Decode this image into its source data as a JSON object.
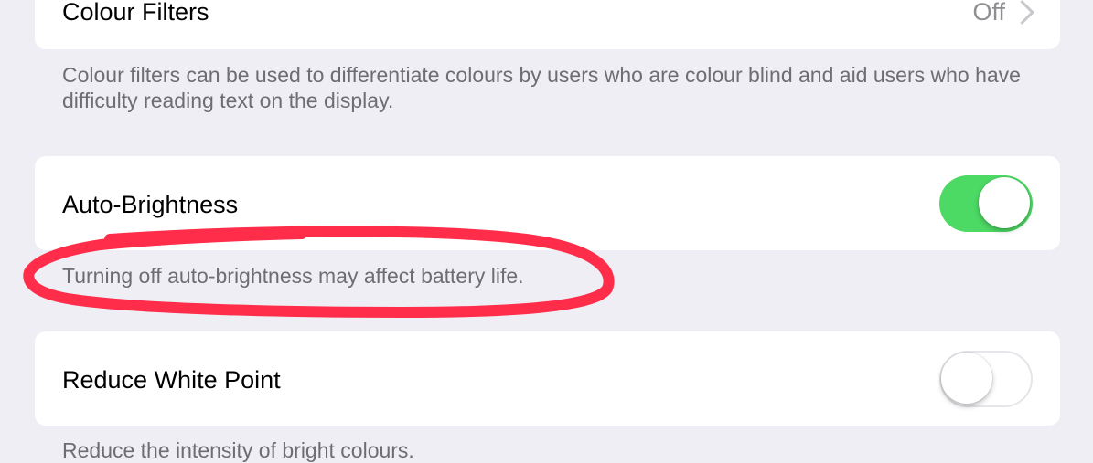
{
  "colour_filters": {
    "label": "Colour Filters",
    "value": "Off",
    "footnote": "Colour filters can be used to differentiate colours by users who are colour blind and aid users who have difficulty reading text on the display."
  },
  "auto_brightness": {
    "label": "Auto-Brightness",
    "state": "on",
    "footnote": "Turning off auto-brightness may affect battery life."
  },
  "reduce_white_point": {
    "label": "Reduce White Point",
    "state": "off",
    "footnote": "Reduce the intensity of bright colours."
  },
  "colors": {
    "background": "#efeef4",
    "toggle_on": "#4cd964",
    "annotation": "#ff2d4a"
  }
}
